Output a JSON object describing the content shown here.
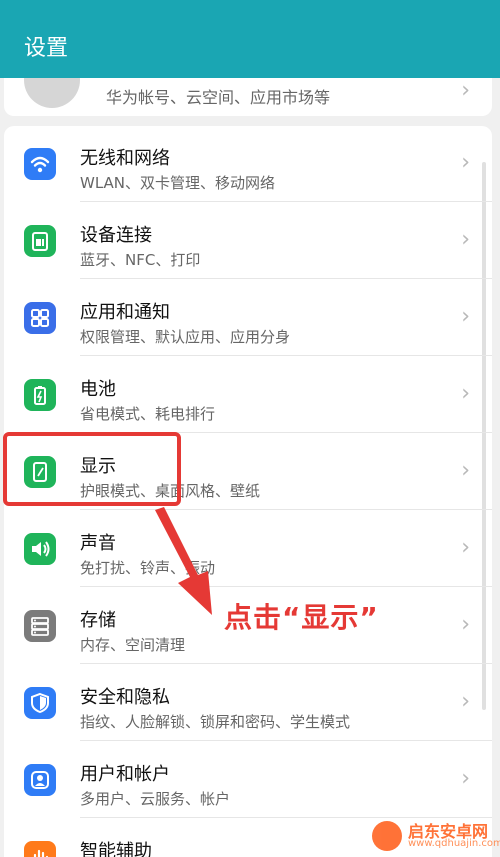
{
  "header": {
    "title": "设置"
  },
  "account": {
    "subtitle": "华为帐号、云空间、应用市场等"
  },
  "settings": [
    {
      "title": "无线和网络",
      "subtitle": "WLAN、双卡管理、移动网络",
      "icon": "wifi-icon",
      "color": "#2f7cf6"
    },
    {
      "title": "设备连接",
      "subtitle": "蓝牙、NFC、打印",
      "icon": "device-connect-icon",
      "color": "#1fb45a"
    },
    {
      "title": "应用和通知",
      "subtitle": "权限管理、默认应用、应用分身",
      "icon": "apps-grid-icon",
      "color": "#3a6ee8"
    },
    {
      "title": "电池",
      "subtitle": "省电模式、耗电排行",
      "icon": "battery-icon",
      "color": "#1fb45a"
    },
    {
      "title": "显示",
      "subtitle": "护眼模式、桌面风格、壁纸",
      "icon": "display-icon",
      "color": "#1fb45a"
    },
    {
      "title": "声音",
      "subtitle": "免打扰、铃声、振动",
      "icon": "sound-icon",
      "color": "#1fb45a"
    },
    {
      "title": "存储",
      "subtitle": "内存、空间清理",
      "icon": "storage-icon",
      "color": "#7b7b7b"
    },
    {
      "title": "安全和隐私",
      "subtitle": "指纹、人脸解锁、锁屏和密码、学生模式",
      "icon": "shield-icon",
      "color": "#2f7cf6"
    },
    {
      "title": "用户和帐户",
      "subtitle": "多用户、云服务、帐户",
      "icon": "user-icon",
      "color": "#2f7cf6"
    },
    {
      "title": "智能辅助",
      "subtitle": "",
      "icon": "assist-icon",
      "color": "#ff7a1a"
    }
  ],
  "annotation": {
    "text": "点击“显示”",
    "color": "#e53935"
  },
  "watermark": {
    "name": "启东安卓网",
    "url": "www.qdhuajin.com"
  },
  "colors": {
    "accent": "#1aa6b3",
    "chevron": "#b8b8b8"
  }
}
